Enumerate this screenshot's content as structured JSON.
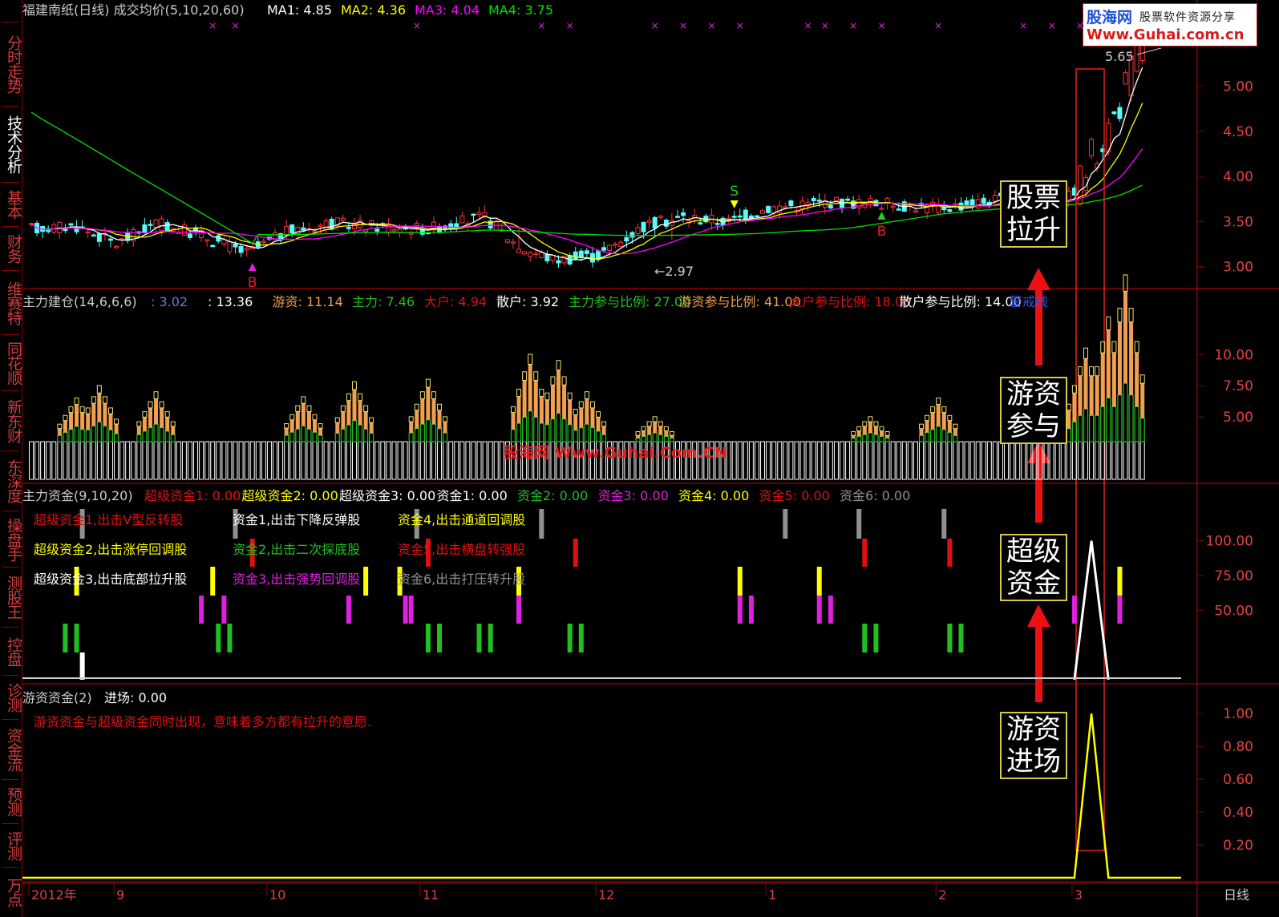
{
  "sidebar": {
    "items": [
      {
        "label": "分时走势",
        "active": false
      },
      {
        "label": "技术分析",
        "active": true
      },
      {
        "label": "基本",
        "active": false
      },
      {
        "label": "财务",
        "active": false
      },
      {
        "label": "维赛特",
        "active": false
      },
      {
        "label": "同花顺",
        "active": false
      },
      {
        "label": "新东财",
        "active": false
      },
      {
        "label": "东深度",
        "active": false
      },
      {
        "label": "操盘手",
        "active": false
      },
      {
        "label": "测股王",
        "active": false
      },
      {
        "label": "控盘",
        "active": false
      },
      {
        "label": "诊测",
        "active": false
      },
      {
        "label": "资金流",
        "active": false
      },
      {
        "label": "预测",
        "active": false
      },
      {
        "label": "评测",
        "active": false
      },
      {
        "label": "万点",
        "active": false
      }
    ]
  },
  "logo": {
    "line1a": "股海网",
    "line1b": "股票软件资源分享",
    "line2": "Www.Guhai.com.cn"
  },
  "watermark": "股海网 Www.Guhai.Com.CN",
  "annotations": [
    "股票拉升",
    "游资参与",
    "超级资金",
    "游资进场"
  ],
  "colors": {
    "up": "#ff3232",
    "down": "#54fcfc",
    "ma1": "#ffffff",
    "ma2": "#ffff00",
    "ma3": "#ff00ff",
    "ma4": "#00e000",
    "orange": "#f0a050",
    "green": "#20c020",
    "magenta": "#e020e0",
    "yellow": "#ffff00",
    "gray": "#909090",
    "red": "#e01010",
    "axis": "#8b0000"
  },
  "panel1": {
    "title": "福建南纸(日线) 成交均价(5,10,20,60)",
    "ma_labels": [
      {
        "name": "MA1:",
        "value": "4.85",
        "color": "#ffffff"
      },
      {
        "name": "MA2:",
        "value": "4.36",
        "color": "#ffff00"
      },
      {
        "name": "MA3:",
        "value": "4.04",
        "color": "#ff00ff"
      },
      {
        "name": "MA4:",
        "value": "3.75",
        "color": "#00e000"
      }
    ],
    "high_label": "5.65",
    "low_label": "2.97",
    "markers": {
      "S": "S",
      "B": "B"
    }
  },
  "panel2": {
    "title": "主力建仓(14,6,6,6)",
    "items": [
      {
        "label": "",
        "value": ": 3.02",
        "color": "#6a7ad8"
      },
      {
        "label": "",
        "value": ": 13.36",
        "color": "#ffffff"
      },
      {
        "label": "游资:",
        "value": "11.14",
        "color": "#f0a050"
      },
      {
        "label": "主力:",
        "value": "7.46",
        "color": "#20c020"
      },
      {
        "label": "大户:",
        "value": "4.94",
        "color": "#e01010"
      },
      {
        "label": "散户:",
        "value": "3.92",
        "color": "#ffffff"
      },
      {
        "label": "主力参与比例:",
        "value": "27.00",
        "color": "#20c020"
      },
      {
        "label": "游资参与比例:",
        "value": "41.00",
        "color": "#f0a050"
      },
      {
        "label": "大户参与比例:",
        "value": "18.00",
        "color": "#e01010"
      },
      {
        "label": "散户参与比例:",
        "value": "14.00",
        "color": "#ffffff"
      },
      {
        "label": "警戒线",
        "value": "",
        "color": "#3050f0"
      }
    ]
  },
  "panel3": {
    "title": "主力资金(9,10,20)",
    "items": [
      {
        "label": "超级资金1:",
        "value": "0.00",
        "color": "#e01010"
      },
      {
        "label": "超级资金2:",
        "value": "0.00",
        "color": "#ffff00"
      },
      {
        "label": "超级资金3:",
        "value": "0.00",
        "color": "#ffffff"
      },
      {
        "label": "资金1:",
        "value": "0.00",
        "color": "#ffffff"
      },
      {
        "label": "资金2:",
        "value": "0.00",
        "color": "#20c020"
      },
      {
        "label": "资金3:",
        "value": "0.00",
        "color": "#e020e0"
      },
      {
        "label": "资金4:",
        "value": "0.00",
        "color": "#ffff00"
      },
      {
        "label": "资金5:",
        "value": "0.00",
        "color": "#e01010"
      },
      {
        "label": "资金6:",
        "value": "0.00",
        "color": "#909090"
      }
    ],
    "legend": [
      {
        "text": "超级资金1,出击V型反转股",
        "color": "#e01010"
      },
      {
        "text": "资金1,出击下降反弹股",
        "color": "#ffffff"
      },
      {
        "text": "资金4,出击通道回调股",
        "color": "#ffff00"
      },
      {
        "text": "超级资金2,出击涨停回调股",
        "color": "#ffff00"
      },
      {
        "text": "资金2,出击二次探底股",
        "color": "#20c020"
      },
      {
        "text": "资金5,出击横盘转强股",
        "color": "#e01010"
      },
      {
        "text": "超级资金3,出击底部拉升股",
        "color": "#ffffff"
      },
      {
        "text": "资金3,出击强势回调股",
        "color": "#e020e0"
      },
      {
        "text": "资金6,出击打压转升股",
        "color": "#909090"
      }
    ]
  },
  "panel4": {
    "title": "游资资金(2)",
    "item": {
      "label": "进场:",
      "value": "0.00",
      "color": "#ffffff"
    },
    "note": "游资资金与超级资金同时出现，意味着多方都有拉升的意愿."
  },
  "footer": {
    "period_label": "日线"
  },
  "chart_data": [
    {
      "type": "candlestick",
      "title": "福建南纸(日线) 成交均价(5,10,20,60)",
      "y_ticks": [
        3.0,
        3.5,
        4.0,
        4.5,
        5.0,
        5.5
      ],
      "ylim": [
        2.8,
        5.78
      ],
      "x_labels": [
        "2012年",
        "9",
        "10",
        "11",
        "12",
        "1",
        "2",
        "3"
      ],
      "x_label_index": [
        0,
        15,
        42,
        69,
        100,
        130,
        160,
        184
      ],
      "ohlc_anchor": [
        [
          0,
          3.42
        ],
        [
          8,
          3.45
        ],
        [
          15,
          3.25
        ],
        [
          22,
          3.48
        ],
        [
          30,
          3.35
        ],
        [
          38,
          3.15
        ],
        [
          45,
          3.38
        ],
        [
          52,
          3.48
        ],
        [
          60,
          3.45
        ],
        [
          70,
          3.42
        ],
        [
          80,
          3.55
        ],
        [
          86,
          3.22
        ],
        [
          92,
          3.08
        ],
        [
          100,
          3.12
        ],
        [
          108,
          3.45
        ],
        [
          115,
          3.55
        ],
        [
          123,
          3.5
        ],
        [
          130,
          3.65
        ],
        [
          140,
          3.72
        ],
        [
          150,
          3.7
        ],
        [
          160,
          3.65
        ],
        [
          168,
          3.72
        ],
        [
          175,
          3.78
        ],
        [
          180,
          3.7
        ],
        [
          185,
          3.85
        ],
        [
          188,
          4.2
        ],
        [
          191,
          4.55
        ],
        [
          194,
          5.05
        ],
        [
          196,
          5.4
        ]
      ],
      "count": 197,
      "series": [
        {
          "name": "MA1",
          "value": 4.85
        },
        {
          "name": "MA2",
          "value": 4.36
        },
        {
          "name": "MA3",
          "value": 4.04
        },
        {
          "name": "MA4",
          "value": 3.75
        }
      ],
      "high": 5.65,
      "low": 2.97
    },
    {
      "type": "bar",
      "title": "主力建仓(14,6,6,6)",
      "y_ticks": [
        5.0,
        7.5,
        10.0
      ],
      "ylim": [
        0,
        14.0
      ],
      "base_level": 3.02,
      "peaks": [
        [
          8,
          3.5
        ],
        [
          12,
          4.5
        ],
        [
          22,
          4.0
        ],
        [
          48,
          3.6
        ],
        [
          57,
          4.8
        ],
        [
          70,
          5.0
        ],
        [
          88,
          7.0
        ],
        [
          93,
          6.5
        ],
        [
          98,
          4.0
        ],
        [
          110,
          2.0
        ],
        [
          148,
          2.0
        ],
        [
          160,
          3.5
        ],
        [
          176,
          4.5
        ],
        [
          186,
          7.5
        ],
        [
          190,
          10.0
        ],
        [
          193,
          13.36
        ]
      ]
    },
    {
      "type": "bar",
      "title": "主力资金(9,10,20)",
      "y_ticks": [
        50.0,
        75.0,
        100.0
      ],
      "ylim": [
        0,
        120
      ],
      "spike_index": 187,
      "spike_value": 100,
      "signals": [
        {
          "name": "资金1",
          "color": "#909090",
          "x": [
            9,
            36,
            68,
            90,
            133,
            146,
            161
          ],
          "level": 3
        },
        {
          "name": "资金5",
          "color": "#e01010",
          "x": [
            39,
            70,
            96,
            147,
            162
          ],
          "level": 2
        },
        {
          "name": "超级资金2",
          "color": "#ffff00",
          "x": [
            8,
            32,
            59,
            65,
            86,
            125,
            139,
            192
          ],
          "level": 1
        },
        {
          "name": "资金3",
          "color": "#e020e0",
          "x": [
            30,
            34,
            56,
            66,
            67,
            86,
            125,
            127,
            139,
            141,
            184,
            192
          ],
          "level": 0
        },
        {
          "name": "资金2",
          "color": "#20c020",
          "x": [
            6,
            8,
            33,
            35,
            70,
            72,
            79,
            81,
            95,
            97,
            147,
            149,
            162,
            164
          ],
          "level": -1
        },
        {
          "name": "超级资金3",
          "color": "#ffffff",
          "x": [
            9
          ],
          "level": -2
        }
      ]
    },
    {
      "type": "line",
      "title": "游资资金(2)",
      "y_ticks": [
        0.2,
        0.4,
        0.6,
        0.8,
        1.0
      ],
      "ylim": [
        0,
        1.05
      ],
      "spike_index": 187,
      "spike_value": 1.0
    }
  ]
}
